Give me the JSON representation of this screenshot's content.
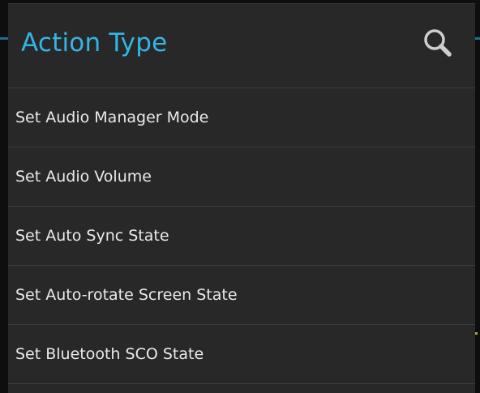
{
  "dialog": {
    "title": "Action Type",
    "search_icon": "search-icon",
    "items": [
      {
        "label": "Set Audio Manager Mode"
      },
      {
        "label": "Set Audio Volume"
      },
      {
        "label": "Set Auto Sync State"
      },
      {
        "label": "Set Auto-rotate Screen State"
      },
      {
        "label": "Set Bluetooth SCO State"
      }
    ]
  },
  "colors": {
    "accent": "#33b5e5",
    "dialog_background": "#282828",
    "divider": "#3d3d3d",
    "text": "#eaeaea"
  }
}
